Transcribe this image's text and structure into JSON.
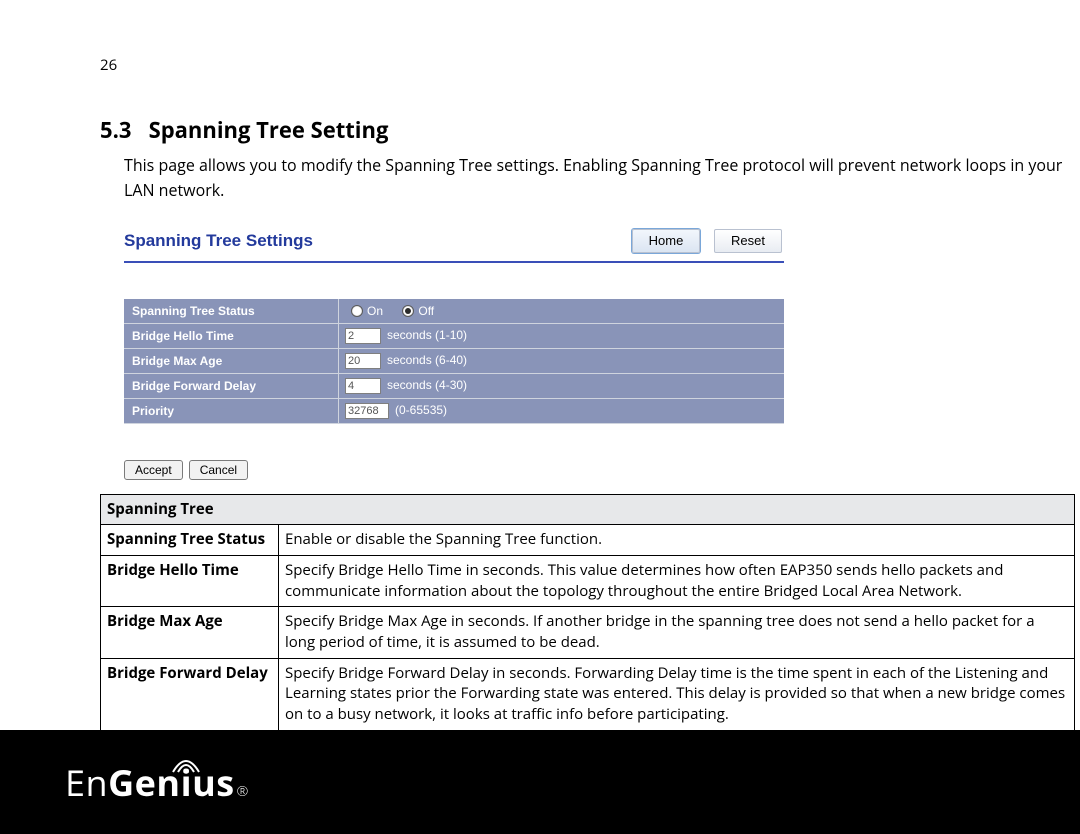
{
  "page_number": "26",
  "section_number": "5.3",
  "section_title": "Spanning Tree Setting",
  "intro_text": "This page allows you to modify the Spanning Tree settings. Enabling Spanning Tree protocol will prevent network loops in your LAN network.",
  "ui": {
    "title": "Spanning Tree Settings",
    "buttons": {
      "home": "Home",
      "reset": "Reset"
    },
    "rows": {
      "status": {
        "label": "Spanning Tree Status",
        "opt_on": "On",
        "opt_off": "Off",
        "selected": "Off"
      },
      "hello": {
        "label": "Bridge Hello Time",
        "value": "2",
        "unit": "seconds (1-10)"
      },
      "maxage": {
        "label": "Bridge Max Age",
        "value": "20",
        "unit": "seconds (6-40)"
      },
      "fwd": {
        "label": "Bridge Forward Delay",
        "value": "4",
        "unit": "seconds (4-30)"
      },
      "prio": {
        "label": "Priority",
        "value": "32768",
        "unit": "(0-65535)"
      }
    },
    "form": {
      "accept": "Accept",
      "cancel": "Cancel"
    }
  },
  "desc": {
    "header": "Spanning Tree",
    "rows": [
      {
        "k": "Spanning Tree Status",
        "v": "Enable or disable the Spanning Tree function."
      },
      {
        "k": "Bridge Hello Time",
        "v": "Specify Bridge Hello Time in seconds. This value determines how often EAP350 sends hello packets and communicate information about the topology throughout the entire Bridged Local Area Network."
      },
      {
        "k": "Bridge Max Age",
        "v": "Specify Bridge Max Age in seconds. If another bridge in the spanning tree does not send a hello packet for a long period of time, it is assumed to be dead."
      },
      {
        "k": "Bridge Forward Delay",
        "v": "Specify Bridge Forward Delay in seconds. Forwarding Delay time is the time spent in each of the Listening and Learning states prior the Forwarding state was entered. This delay is provided so that when a new bridge comes on to a busy network, it looks at traffic info before participating."
      }
    ]
  },
  "brand": {
    "part1": "En",
    "part2": "Genius",
    "reg": "®"
  }
}
